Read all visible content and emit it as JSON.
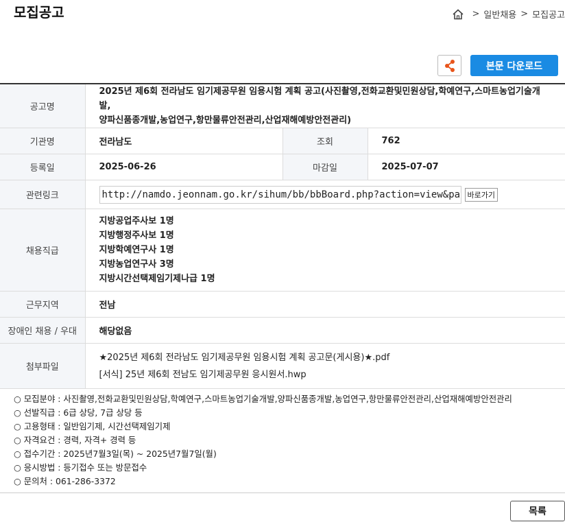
{
  "page_title": "모집공고",
  "breadcrumb": {
    "items": [
      "일반채용",
      "모집공고"
    ],
    "sep": ">"
  },
  "actions": {
    "download_label": "본문 다운로드"
  },
  "details": {
    "title_label": "공고명",
    "title": "2025년 제6회 전라남도 임기제공무원 임용시험 계획 공고(사진촬영,전화교환및민원상담,학예연구,스마트농업기술개발,",
    "title_line2": "양파신품종개발,농업연구,항만물류안전관리,산업재해예방안전관리)",
    "agency_label": "기관명",
    "agency": "전라남도",
    "views_label": "조회",
    "views": "762",
    "registered_label": "등록일",
    "registered": "2025-06-26",
    "deadline_label": "마감일",
    "deadline": "2025-07-07",
    "link_label": "관련링크",
    "link": "http://namdo.jeonnam.go.kr/sihum/bb/bbBoard.php?action=view&page",
    "go_label": "바로가기",
    "positions_label": "채용직급",
    "positions": [
      "지방공업주사보 1명",
      "지방행정주사보 1명",
      "지방학예연구사 1명",
      "지방농업연구사 3명",
      "지방시간선택제임기제나급 1명"
    ],
    "region_label": "근무지역",
    "region": "전남",
    "disabled_label": "장애인 채용 / 우대",
    "disabled": "해당없음",
    "attach_label": "첨부파일",
    "attachments": [
      "★2025년 제6회 전라남도 임기제공무원 임용시험 계획 공고문(게시용)★.pdf",
      "[서식] 25년 제6회 전남도 임기제공무원 응시원서.hwp"
    ]
  },
  "notes": [
    "○ 모집분야 : 사진촬영,전화교환및민원상담,학예연구,스마트농업기술개발,양파신품종개발,농업연구,항만물류안전관리,산업재해예방안전관리",
    "○ 선발직급 : 6급 상당, 7급 상당 등",
    "○ 고용형태 : 일반임기제, 시간선택제임기제",
    "○ 자격요건 : 경력, 자격+ 경력 등",
    "○ 접수기간 : 2025년7월3일(목) ~ 2025년7월7일(월)",
    "○ 응시방법 : 등기접수 또는 방문접수",
    "○ 문의처 : 061-286-3372"
  ],
  "footer": {
    "list_label": "목록"
  },
  "colors": {
    "accent": "#1a8be3",
    "share": "#e8541a",
    "header_bg": "#f4f6f9"
  },
  "icons": {
    "home": "home-icon",
    "share": "share-icon"
  }
}
